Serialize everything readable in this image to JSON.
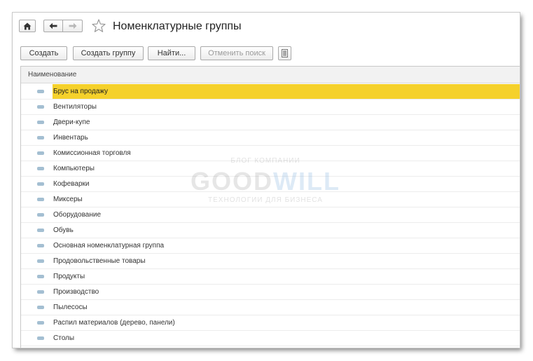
{
  "window": {
    "title": "Номенклатурные группы"
  },
  "toolbar": {
    "create_label": "Создать",
    "create_group_label": "Создать группу",
    "find_label": "Найти...",
    "cancel_search_label": "Отменить поиск"
  },
  "icons": {
    "home": "home-icon",
    "back": "arrow-left-icon",
    "forward": "arrow-right-icon",
    "favorite": "star-icon",
    "more": "more-menu-icon",
    "item": "item-icon"
  },
  "colors": {
    "selection": "#f5d12b",
    "item_icon": "#a4bfd2"
  },
  "table": {
    "column_header": "Наименование",
    "selected_index": 0,
    "rows": [
      "Брус на продажу",
      "Вентиляторы",
      "Двери-купе",
      "Инвентарь",
      "Комиссионная торговля",
      "Компьютеры",
      "Кофеварки",
      "Миксеры",
      "Оборудование",
      "Обувь",
      "Основная номенклатурная группа",
      "Продовольственные товары",
      "Продукты",
      "Производство",
      "Пылесосы",
      "Распил материалов (дерево, панели)",
      "Столы"
    ]
  },
  "watermark": {
    "top": "БЛОГ КОМПАНИИ",
    "main_a": "GOOD",
    "main_b": "WILL",
    "bottom": "ТЕХНОЛОГИИ ДЛЯ БИЗНЕСА"
  }
}
